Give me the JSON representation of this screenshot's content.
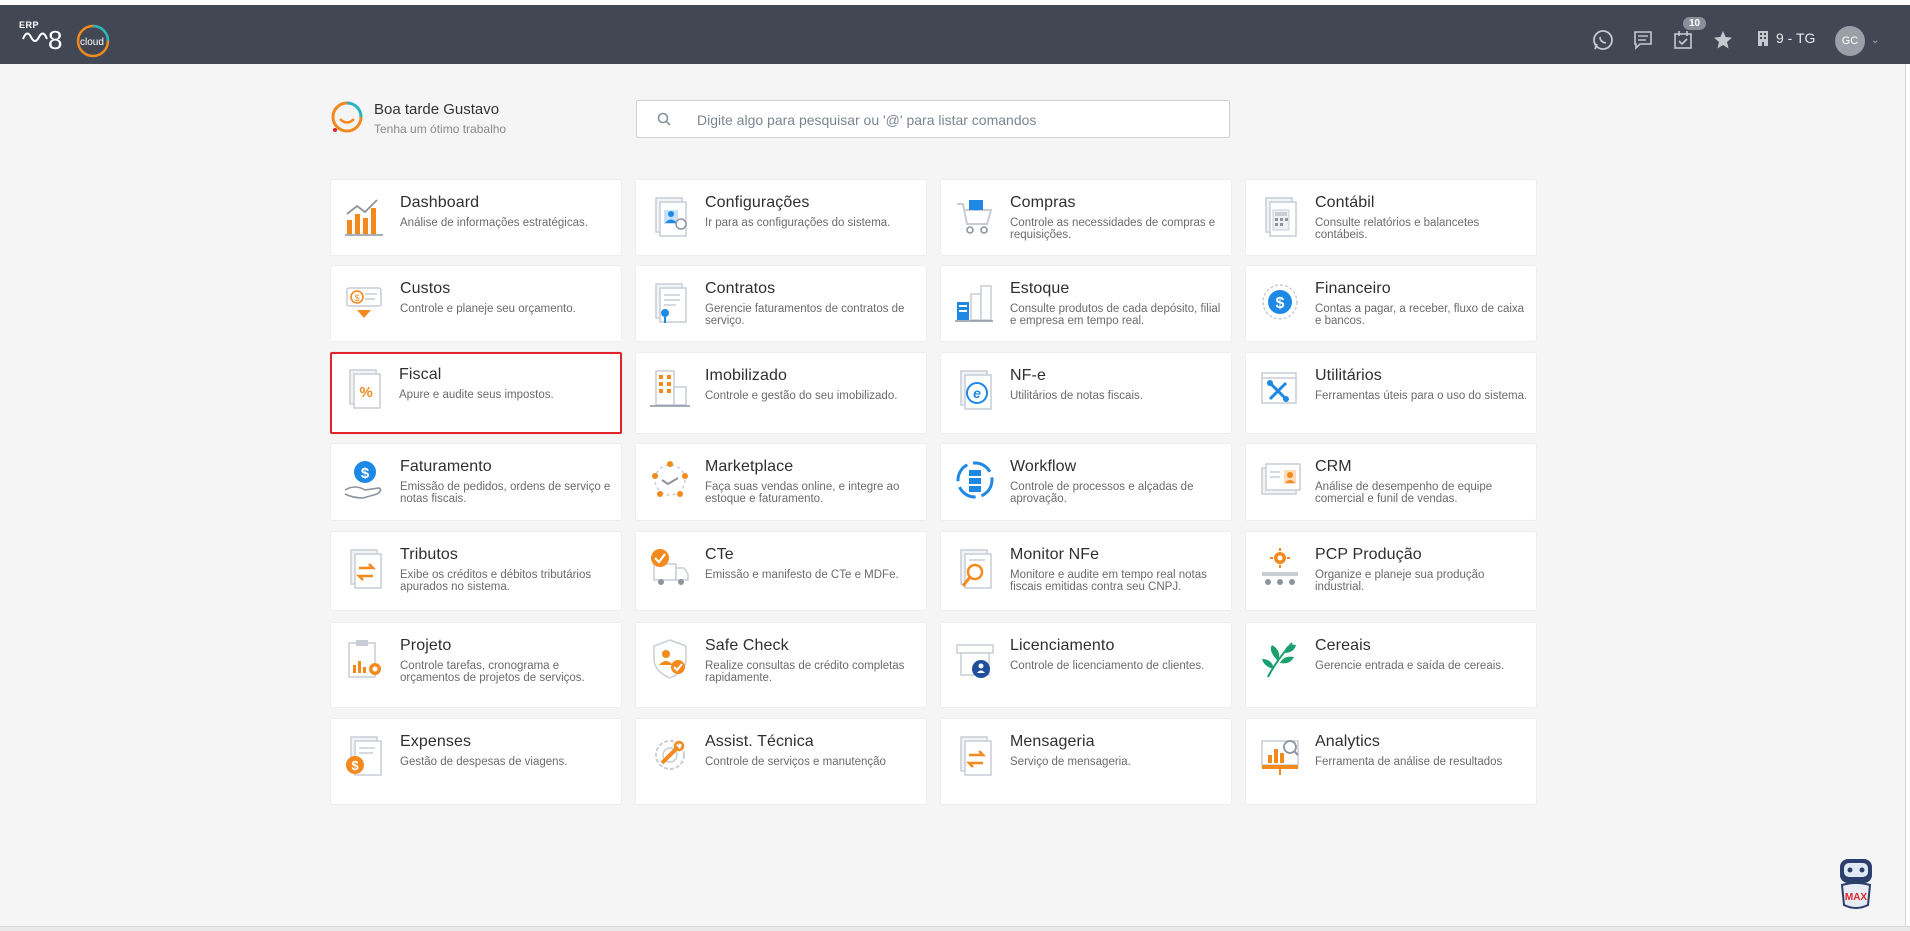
{
  "topbar": {
    "logo_tag": "ERP",
    "logo_cloud": "cloud",
    "notification_count": "10",
    "company": "9 - TG",
    "avatar_initials": "GC"
  },
  "greeting": {
    "title": "Boa tarde Gustavo",
    "subtitle": "Tenha um ótimo trabalho"
  },
  "search": {
    "placeholder": "Digite algo para pesquisar ou '@' para listar comandos"
  },
  "modules": [
    {
      "title": "Dashboard",
      "desc": "Análise de informações estratégicas.",
      "icon": "dashboard-chart-icon"
    },
    {
      "title": "Configurações",
      "desc": "Ir para as configurações do sistema.",
      "icon": "settings-profile-icon"
    },
    {
      "title": "Compras",
      "desc": "Controle as necessidades de compras e requisições.",
      "icon": "shopping-cart-icon"
    },
    {
      "title": "Contábil",
      "desc": "Consulte relatórios e balancetes contábeis.",
      "icon": "calculator-document-icon"
    },
    {
      "title": "Custos",
      "desc": "Controle e planeje seu orçamento.",
      "icon": "cost-money-icon"
    },
    {
      "title": "Contratos",
      "desc": "Gerencie faturamentos de contratos de serviço.",
      "icon": "contract-document-icon"
    },
    {
      "title": "Estoque",
      "desc": "Consulte produtos de cada depósito, filial e empresa em tempo real.",
      "icon": "warehouse-icon"
    },
    {
      "title": "Financeiro",
      "desc": "Contas a pagar, a receber, fluxo de caixa e bancos.",
      "icon": "dollar-coin-icon"
    },
    {
      "title": "Fiscal",
      "desc": "Apure e audite seus impostos.",
      "icon": "percent-document-icon"
    },
    {
      "title": "Imobilizado",
      "desc": "Controle e gestão do seu imobilizado.",
      "icon": "building-icon"
    },
    {
      "title": "NF-e",
      "desc": "Utilitários de notas fiscais.",
      "icon": "electronic-invoice-icon"
    },
    {
      "title": "Utilitários",
      "desc": "Ferramentas úteis para o uso do sistema.",
      "icon": "tools-icon"
    },
    {
      "title": "Faturamento",
      "desc": "Emissão de pedidos, ordens de serviço e notas fiscais.",
      "icon": "hand-dollar-icon"
    },
    {
      "title": "Marketplace",
      "desc": "Faça suas vendas online, e integre ao estoque e faturamento.",
      "icon": "handshake-network-icon"
    },
    {
      "title": "Workflow",
      "desc": "Controle de processos e alçadas de aprovação.",
      "icon": "workflow-cycle-icon"
    },
    {
      "title": "CRM",
      "desc": "Análise de desempenho de equipe comercial e funil de vendas.",
      "icon": "crm-profile-icon"
    },
    {
      "title": "Tributos",
      "desc": "Exibe os créditos e débitos tributários apurados no sistema.",
      "icon": "tax-exchange-icon"
    },
    {
      "title": "CTe",
      "desc": "Emissão e manifesto de CTe e MDFe.",
      "icon": "truck-check-icon"
    },
    {
      "title": "Monitor NFe",
      "desc": "Monitore e audite em tempo real notas fiscais emitidas contra seu CNPJ.",
      "icon": "magnifier-document-icon"
    },
    {
      "title": "PCP Produção",
      "desc": "Organize e planeje sua produção industrial.",
      "icon": "production-gear-icon"
    },
    {
      "title": "Projeto",
      "desc": "Controle tarefas, cronograma e orçamentos de projetos de serviços.",
      "icon": "clipboard-gear-icon"
    },
    {
      "title": "Safe Check",
      "desc": "Realize consultas de crédito completas rapidamente.",
      "icon": "shield-check-icon"
    },
    {
      "title": "Licenciamento",
      "desc": "Controle de licenciamento de clientes.",
      "icon": "license-store-icon"
    },
    {
      "title": "Cereais",
      "desc": "Gerencie entrada e saída de cereais.",
      "icon": "leaf-icon"
    },
    {
      "title": "Expenses",
      "desc": "Gestão de despesas de viagens.",
      "icon": "expense-dollar-icon"
    },
    {
      "title": "Assist. Técnica",
      "desc": "Controle de serviços e manutenção",
      "icon": "wrench-gear-icon"
    },
    {
      "title": "Mensageria",
      "desc": "Serviço de mensageria.",
      "icon": "message-exchange-icon"
    },
    {
      "title": "Analytics",
      "desc": "Ferramenta de análise de resultados",
      "icon": "analytics-magnifier-icon"
    }
  ],
  "selected_module": "Fiscal",
  "assistant": {
    "label": "MAX"
  },
  "colors": {
    "topbar": "#414854",
    "accent_orange": "#f28a1e",
    "accent_blue": "#1e88e5",
    "selection_border": "#e0242b",
    "background": "#f5f5f6"
  }
}
